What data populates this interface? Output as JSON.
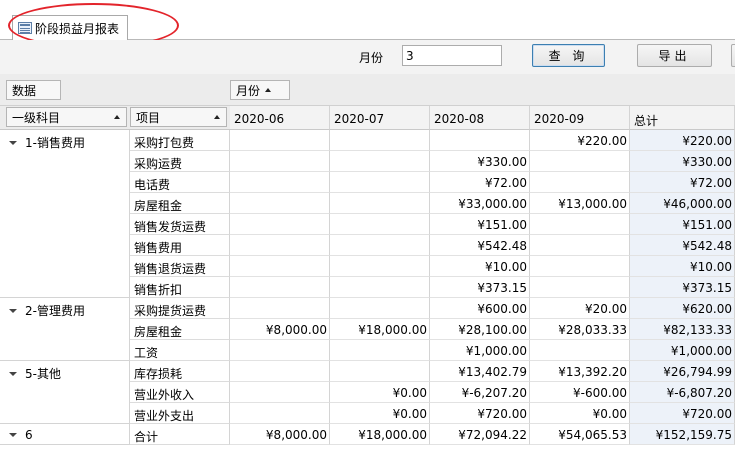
{
  "tab": {
    "label": "阶段损益月报表"
  },
  "filter": {
    "month_label": "月份",
    "month_value": "3",
    "query_button": "查 询",
    "export_button": "导出"
  },
  "pivot": {
    "data_field": "数据",
    "column_field": "月份",
    "row_fields": [
      "一级科目",
      "项目"
    ],
    "columns": [
      "2020-06",
      "2020-07",
      "2020-08",
      "2020-09",
      "总计"
    ],
    "groups": [
      {
        "label": "1-销售费用",
        "rows": [
          {
            "item": "采购打包费",
            "values": [
              "",
              "",
              "",
              "¥220.00",
              "¥220.00"
            ]
          },
          {
            "item": "采购运费",
            "values": [
              "",
              "",
              "¥330.00",
              "",
              "¥330.00"
            ]
          },
          {
            "item": "电话费",
            "values": [
              "",
              "",
              "¥72.00",
              "",
              "¥72.00"
            ]
          },
          {
            "item": "房屋租金",
            "values": [
              "",
              "",
              "¥33,000.00",
              "¥13,000.00",
              "¥46,000.00"
            ]
          },
          {
            "item": "销售发货运费",
            "values": [
              "",
              "",
              "¥151.00",
              "",
              "¥151.00"
            ]
          },
          {
            "item": "销售费用",
            "values": [
              "",
              "",
              "¥542.48",
              "",
              "¥542.48"
            ]
          },
          {
            "item": "销售退货运费",
            "values": [
              "",
              "",
              "¥10.00",
              "",
              "¥10.00"
            ]
          },
          {
            "item": "销售折扣",
            "values": [
              "",
              "",
              "¥373.15",
              "",
              "¥373.15"
            ]
          }
        ]
      },
      {
        "label": "2-管理费用",
        "rows": [
          {
            "item": "采购提货运费",
            "values": [
              "",
              "",
              "¥600.00",
              "¥20.00",
              "¥620.00"
            ]
          },
          {
            "item": "房屋租金",
            "values": [
              "¥8,000.00",
              "¥18,000.00",
              "¥28,100.00",
              "¥28,033.33",
              "¥82,133.33"
            ]
          },
          {
            "item": "工资",
            "values": [
              "",
              "",
              "¥1,000.00",
              "",
              "¥1,000.00"
            ]
          }
        ]
      },
      {
        "label": "5-其他",
        "rows": [
          {
            "item": "库存损耗",
            "values": [
              "",
              "",
              "¥13,402.79",
              "¥13,392.20",
              "¥26,794.99"
            ]
          },
          {
            "item": "营业外收入",
            "values": [
              "",
              "¥0.00",
              "¥-6,207.20",
              "¥-600.00",
              "¥-6,807.20"
            ]
          },
          {
            "item": "营业外支出",
            "values": [
              "",
              "¥0.00",
              "¥720.00",
              "¥0.00",
              "¥720.00"
            ]
          }
        ]
      },
      {
        "label": "6",
        "rows": [
          {
            "item": "合计",
            "values": [
              "¥8,000.00",
              "¥18,000.00",
              "¥72,094.22",
              "¥54,065.53",
              "¥152,159.75"
            ]
          }
        ]
      }
    ]
  }
}
